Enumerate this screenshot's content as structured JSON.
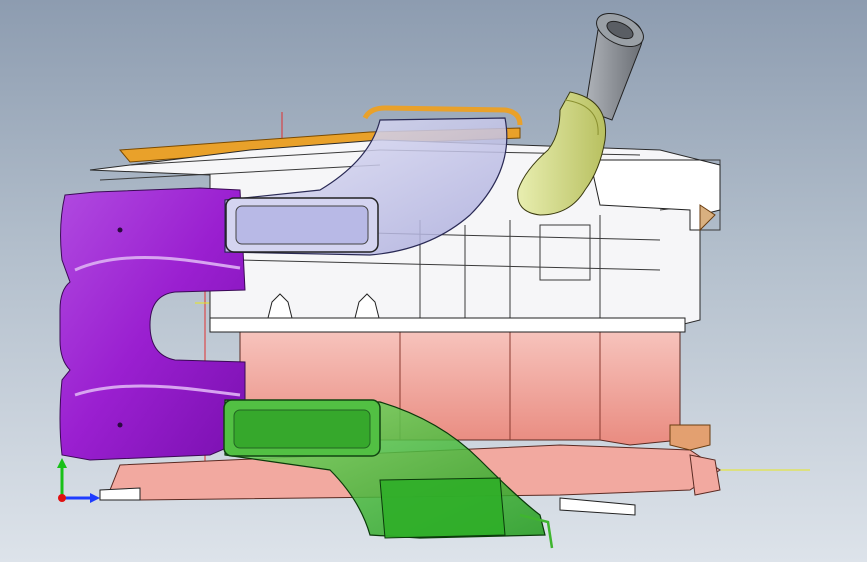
{
  "viewport": {
    "background_top": "#8d9cb0",
    "background_bottom": "#dde3ea"
  },
  "model": {
    "parts": [
      {
        "id": "purple-frame",
        "color": "#a52bd6"
      },
      {
        "id": "blue-duct",
        "color": "#c8c9ec"
      },
      {
        "id": "green-duct",
        "color": "#3fb52f"
      },
      {
        "id": "yellow-hose",
        "color": "#d6de8c"
      },
      {
        "id": "gray-tube",
        "color": "#8a8f96"
      },
      {
        "id": "pink-housing",
        "color": "#f2a9a0"
      },
      {
        "id": "white-housing",
        "color": "#f6f6f8"
      },
      {
        "id": "orange-rail",
        "color": "#e9a12a"
      }
    ]
  },
  "axes": {
    "x_color": "#1e3cff",
    "y_color": "#18c018",
    "z_color": "#e01010",
    "origin_line_color": "#e03030",
    "yellow_line_color": "#e8e820"
  }
}
